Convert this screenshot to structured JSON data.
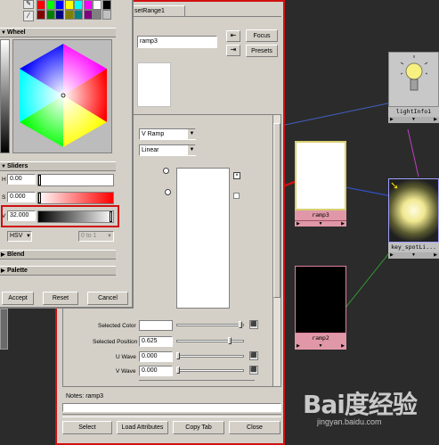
{
  "attr_editor": {
    "top_tab": "setRange1",
    "name_value": "ramp3",
    "focus_label": "Focus",
    "presets_label": "Presets",
    "ramp_type": "V Ramp",
    "interpolation": "Linear",
    "selected_color_label": "Selected Color",
    "selected_position_label": "Selected Position",
    "selected_position_value": "0.625",
    "u_wave_label": "U Wave",
    "u_wave_value": "0.000",
    "v_wave_label": "V Wave",
    "v_wave_value": "0.000",
    "notes_label": "Notes:",
    "notes_value": "ramp3",
    "buttons": [
      "Select",
      "Load Attributes",
      "Copy Tab",
      "Close"
    ]
  },
  "color_chooser": {
    "wheel_label": "Wheel",
    "sliders_label": "Sliders",
    "h_label": "H",
    "h_value": "0.00",
    "s_label": "S",
    "s_value": "0.000",
    "v_label": "V",
    "v_value": "32.000",
    "mode": "HSV",
    "range": "0 to 1",
    "blend_label": "Blend",
    "palette_label": "Palette",
    "accept_label": "Accept",
    "reset_label": "Reset",
    "cancel_label": "Cancel",
    "palette_colors": [
      "#ff0000",
      "#00ff00",
      "#0000ff",
      "#ffff00",
      "#00ffff",
      "#ff00ff",
      "#ffffff",
      "#000000",
      "#800000",
      "#008000",
      "#000080",
      "#808000",
      "#008080",
      "#800080",
      "#808080",
      "#c0c0c0"
    ]
  },
  "hypershade": {
    "nodes": [
      {
        "label": "ramp3",
        "swatch": "#ffffff",
        "border": "#d8d070"
      },
      {
        "label": "ramp2",
        "swatch": "#000000",
        "border": "#e080a0"
      },
      {
        "label": "lightInfo1",
        "swatch": "#c8c8c8",
        "border": "#c0c0c0"
      },
      {
        "label": "key_spotLi...",
        "swatch": "#f8f4d0",
        "border": "#a0a0ff"
      }
    ]
  },
  "watermark": {
    "brand": "Bai度经验",
    "url": "jingyan.baidu.com"
  },
  "colors": {
    "highlight_red": "#d01010",
    "panel_gray": "#d4d0c8",
    "canvas_dark": "#2a2a2a"
  }
}
